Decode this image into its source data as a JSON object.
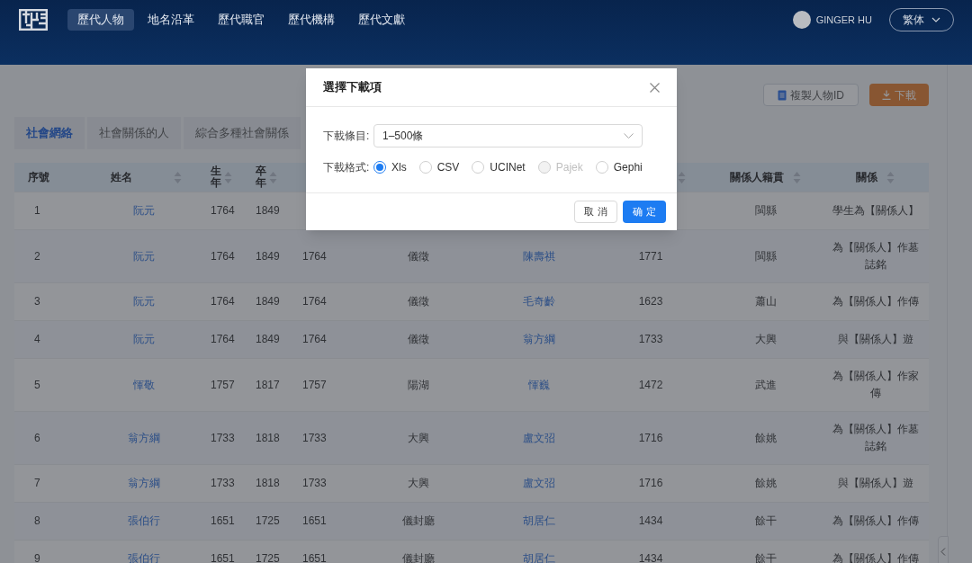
{
  "nav": {
    "items": [
      {
        "label": "歷代人物",
        "selected": true
      },
      {
        "label": "地名沿革",
        "selected": false
      },
      {
        "label": "歷代職官",
        "selected": false
      },
      {
        "label": "歷代機構",
        "selected": false
      },
      {
        "label": "歷代文獻",
        "selected": false
      }
    ],
    "user": {
      "name": "GINGER HU"
    },
    "language": {
      "value": "繁体"
    }
  },
  "toolbar": {
    "copy_button": "複製人物ID",
    "download_button": "下載"
  },
  "tabs": [
    {
      "label": "社會網絡",
      "selected": true
    },
    {
      "label": "社會關係的人",
      "selected": false
    },
    {
      "label": "綜合多種社會關係",
      "selected": false
    }
  ],
  "table": {
    "columns": [
      {
        "label": "序號",
        "sortable": false
      },
      {
        "label": "姓名",
        "sortable": true
      },
      {
        "label": "生年",
        "sortable": true
      },
      {
        "label": "卒年",
        "sortable": true
      },
      {},
      {},
      {},
      {
        "sortable": true
      },
      {
        "label": "關係人籍貫",
        "sortable": true
      },
      {
        "label": "關係",
        "sortable": true
      }
    ],
    "rows": [
      {
        "cells": [
          "1",
          "阮元",
          "1764",
          "1849",
          null,
          null,
          null,
          null,
          "閩縣",
          "學生為【關係人】"
        ]
      },
      {
        "cells": [
          "2",
          "阮元",
          "1764",
          "1849",
          "1764",
          "儀徵",
          "陳壽祺",
          "1771",
          "閩縣",
          "為【關係人】作墓誌銘"
        ]
      },
      {
        "cells": [
          "3",
          "阮元",
          "1764",
          "1849",
          "1764",
          "儀徵",
          "毛奇齡",
          "1623",
          "蕭山",
          "為【關係人】作傳"
        ]
      },
      {
        "cells": [
          "4",
          "阮元",
          "1764",
          "1849",
          "1764",
          "儀徵",
          "翁方綱",
          "1733",
          "大興",
          "與【關係人】遊"
        ]
      },
      {
        "cells": [
          "5",
          "惲敬",
          "1757",
          "1817",
          "1757",
          "陽湖",
          "惲巍",
          "1472",
          "武進",
          "為【關係人】作家傳"
        ]
      },
      {
        "cells": [
          "6",
          "翁方綱",
          "1733",
          "1818",
          "1733",
          "大興",
          "盧文弨",
          "1716",
          "餘姚",
          "為【關係人】作墓誌銘"
        ]
      },
      {
        "cells": [
          "7",
          "翁方綱",
          "1733",
          "1818",
          "1733",
          "大興",
          "盧文弨",
          "1716",
          "餘姚",
          "與【關係人】遊"
        ]
      },
      {
        "cells": [
          "8",
          "張伯行",
          "1651",
          "1725",
          "1651",
          "儀封廳",
          "胡居仁",
          "1434",
          "餘干",
          "為【關係人】作傳"
        ]
      },
      {
        "cells": [
          "9",
          "張伯行",
          "1651",
          "1725",
          "1651",
          "儀封廳",
          "胡居仁",
          "1434",
          "餘干",
          "為【關係人】作傳"
        ]
      }
    ]
  },
  "dialog": {
    "title": "選擇下載項",
    "range": {
      "label": "下載條目:",
      "value": "1–500條"
    },
    "format": {
      "label": "下載格式:",
      "options": [
        {
          "label": "Xls",
          "selected": true,
          "disabled": false
        },
        {
          "label": "CSV",
          "selected": false,
          "disabled": false
        },
        {
          "label": "UCINet",
          "selected": false,
          "disabled": false
        },
        {
          "label": "Pajek",
          "selected": false,
          "disabled": true
        },
        {
          "label": "Gephi",
          "selected": false,
          "disabled": false
        }
      ]
    },
    "cancel_button": "取 消",
    "ok_button": "确 定"
  }
}
